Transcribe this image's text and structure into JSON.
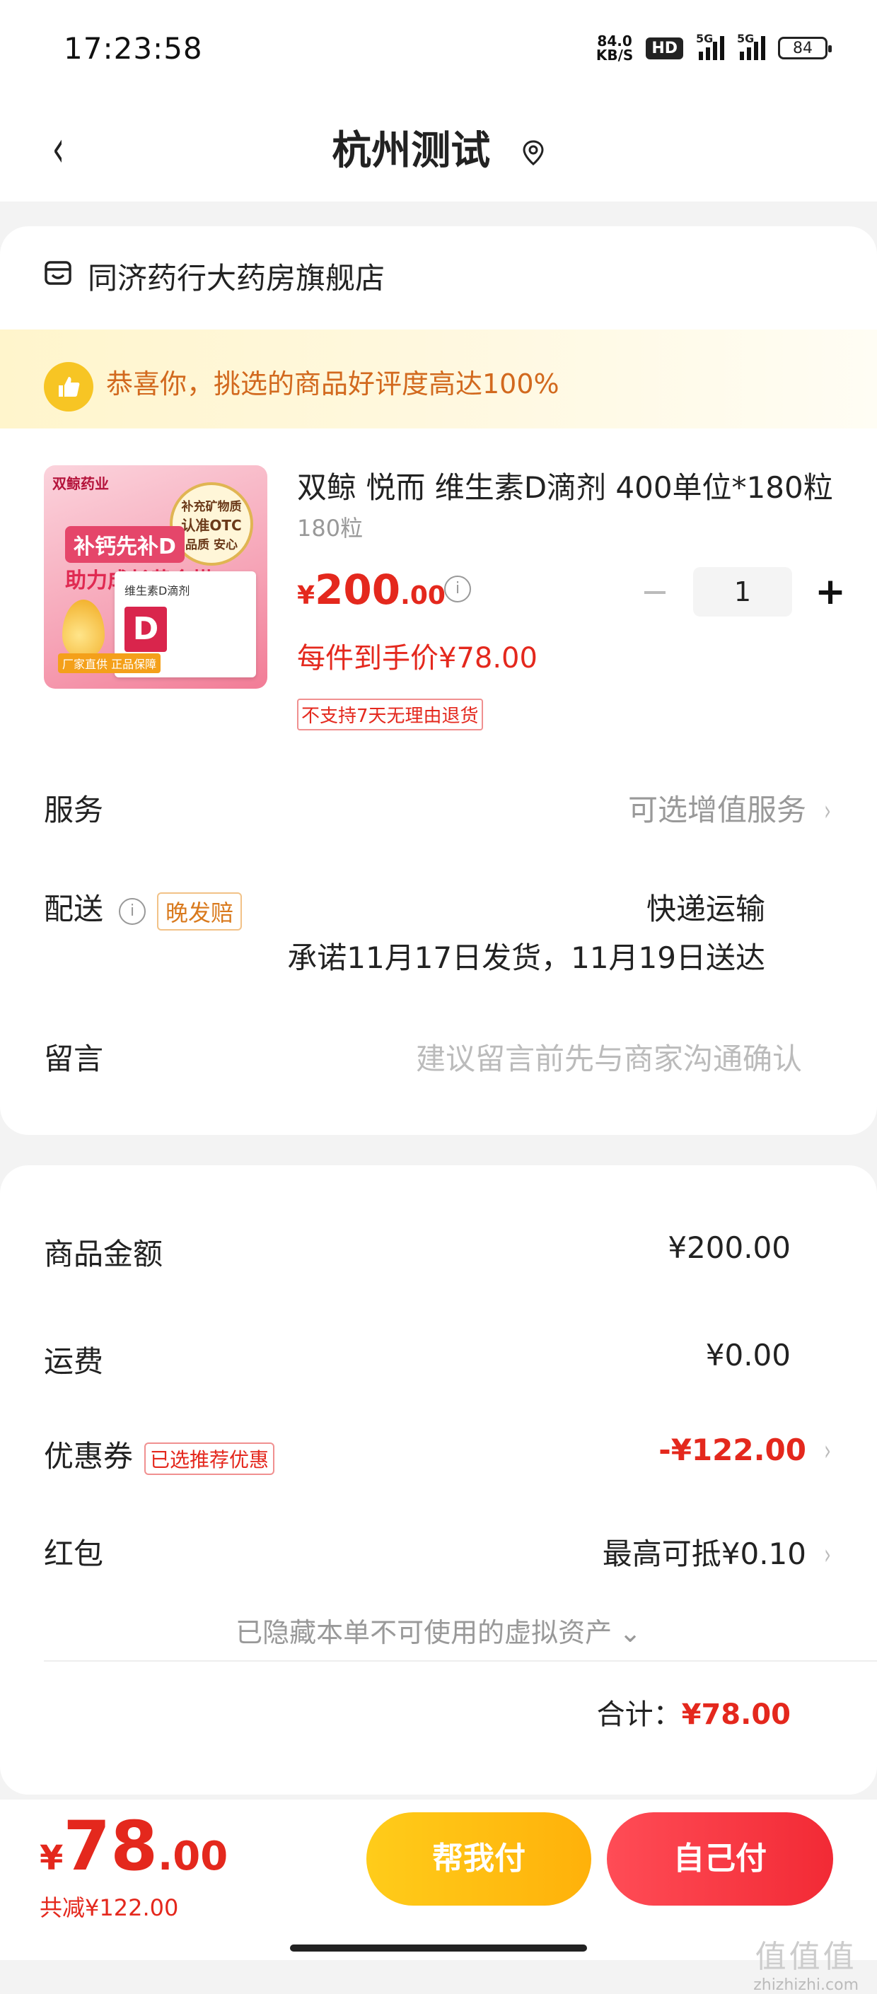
{
  "status_bar": {
    "time": "17:23:58",
    "net_speed": "84.0",
    "net_unit": "KB/S",
    "hd_label": "HD",
    "signal1": "5G",
    "signal2": "5G",
    "battery": "84"
  },
  "nav": {
    "back_icon": "chevron-left-icon",
    "title": "杭州测试",
    "location_icon": "location-pin-icon"
  },
  "store": {
    "icon": "store-icon",
    "name": "同济药行大药房旗舰店"
  },
  "banner": {
    "icon": "thumbs-up-icon",
    "text": "恭喜你，挑选的商品好评度高达100%"
  },
  "product": {
    "image_brand": "双鲸药业",
    "image_otc_line1": "补充矿物质",
    "image_otc_line2": "认准OTC",
    "image_otc_line3": "品质 安心",
    "image_slogan1": "补钙先补D",
    "image_slogan2": "助力成长黄金搭",
    "image_box_title": "维生素D滴剂",
    "image_box_letter": "D",
    "image_bottom": "厂家直供 正品保障",
    "title": "双鲸 悦而 维生素D滴剂 400单位*180粒",
    "spec": "180粒",
    "price_currency": "¥",
    "price_int": "200",
    "price_dec": ".00",
    "quantity": "1",
    "minus_symbol": "−",
    "plus_symbol": "+",
    "deal_price": "每件到手价¥78.00",
    "no_refund_tag": "不支持7天无理由退货"
  },
  "service": {
    "label": "服务",
    "value": "可选增值服务"
  },
  "delivery": {
    "label": "配送",
    "tag": "晚发赔",
    "method": "快递运输",
    "promise": "承诺11月17日发货，11月19日送达"
  },
  "message": {
    "label": "留言",
    "placeholder": "建议留言前先与商家沟通确认"
  },
  "summary": {
    "goods_label": "商品金额",
    "goods_value": "¥200.00",
    "shipping_label": "运费",
    "shipping_value": "¥0.00",
    "coupon_label": "优惠券",
    "coupon_tag": "已选推荐优惠",
    "coupon_value": "-¥122.00",
    "redpacket_label": "红包",
    "redpacket_value": "最高可抵¥0.10",
    "hidden_assets": "已隐藏本单不可使用的虚拟资产",
    "total_label": "合计：",
    "total_value": "¥78.00"
  },
  "footer": {
    "price_currency": "¥",
    "price_int": "78",
    "price_dec": ".00",
    "saved": "共减¥122.00",
    "help_pay_button": "帮我付",
    "self_pay_button": "自己付",
    "watermark_big": "值值值",
    "watermark_small": "zhizhizhi.com"
  },
  "colors": {
    "accent_red": "#e4281d",
    "help_button": "#ffbf12",
    "self_button": "#f2333d",
    "banner_text": "#d2691e"
  }
}
